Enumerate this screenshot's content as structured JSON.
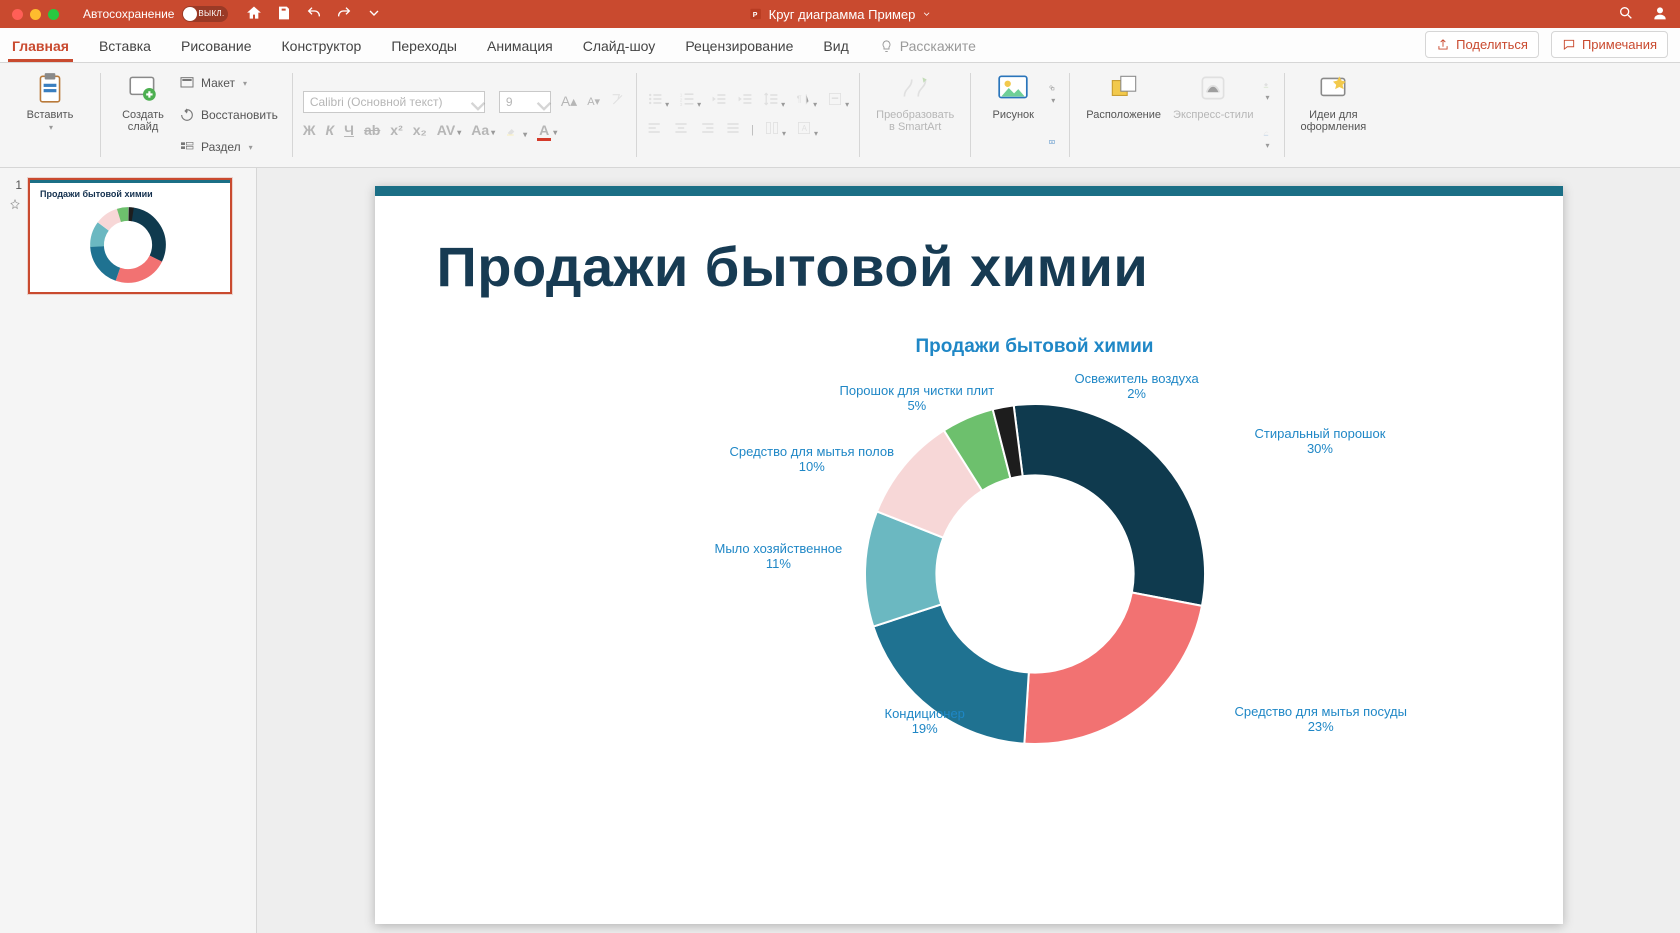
{
  "titlebar": {
    "autosave_label": "Автосохранение",
    "autosave_state": "ВЫКЛ.",
    "document_title": "Круг диаграмма Пример"
  },
  "tabs": {
    "items": [
      "Главная",
      "Вставка",
      "Рисование",
      "Конструктор",
      "Переходы",
      "Анимация",
      "Слайд-шоу",
      "Рецензирование",
      "Вид"
    ],
    "tell_me": "Расскажите",
    "active": "Главная"
  },
  "top_right": {
    "share": "Поделиться",
    "comments": "Примечания"
  },
  "ribbon": {
    "paste": "Вставить",
    "new_slide": "Создать\nслайд",
    "layout": "Макет",
    "reset": "Восстановить",
    "section": "Раздел",
    "font_name": "Calibri (Основной текст)",
    "font_size": "9",
    "convert_smartart": "Преобразовать\nв SmartArt",
    "picture": "Рисунок",
    "arrange": "Расположение",
    "quick_styles": "Экспресс-стили",
    "design_ideas": "Идеи для\nоформления"
  },
  "slide": {
    "title": "Продажи бытовой химии"
  },
  "chart_data": {
    "type": "pie",
    "title": "Продажи бытовой химии",
    "series": [
      {
        "name": "Стиральный порошок",
        "value": 30,
        "color": "#0f3a4e"
      },
      {
        "name": "Средство для мытья посуды",
        "value": 23,
        "color": "#f27272"
      },
      {
        "name": "Кондиционер",
        "value": 19,
        "color": "#1f7291"
      },
      {
        "name": "Мыло хозяйственное",
        "value": 11,
        "color": "#6bb8c1"
      },
      {
        "name": "Средство для мытья полов",
        "value": 10,
        "color": "#f7d7d7"
      },
      {
        "name": "Порошок для чистки плит",
        "value": 5,
        "color": "#6dc06d"
      },
      {
        "name": "Освежитель воздуха",
        "value": 2,
        "color": "#1d1d1d"
      }
    ],
    "inner_radius_ratio": 0.58,
    "label_format": "{name}\n{value}%"
  },
  "thumbnail": {
    "index": "1",
    "title": "Продажи бытовой химии"
  }
}
